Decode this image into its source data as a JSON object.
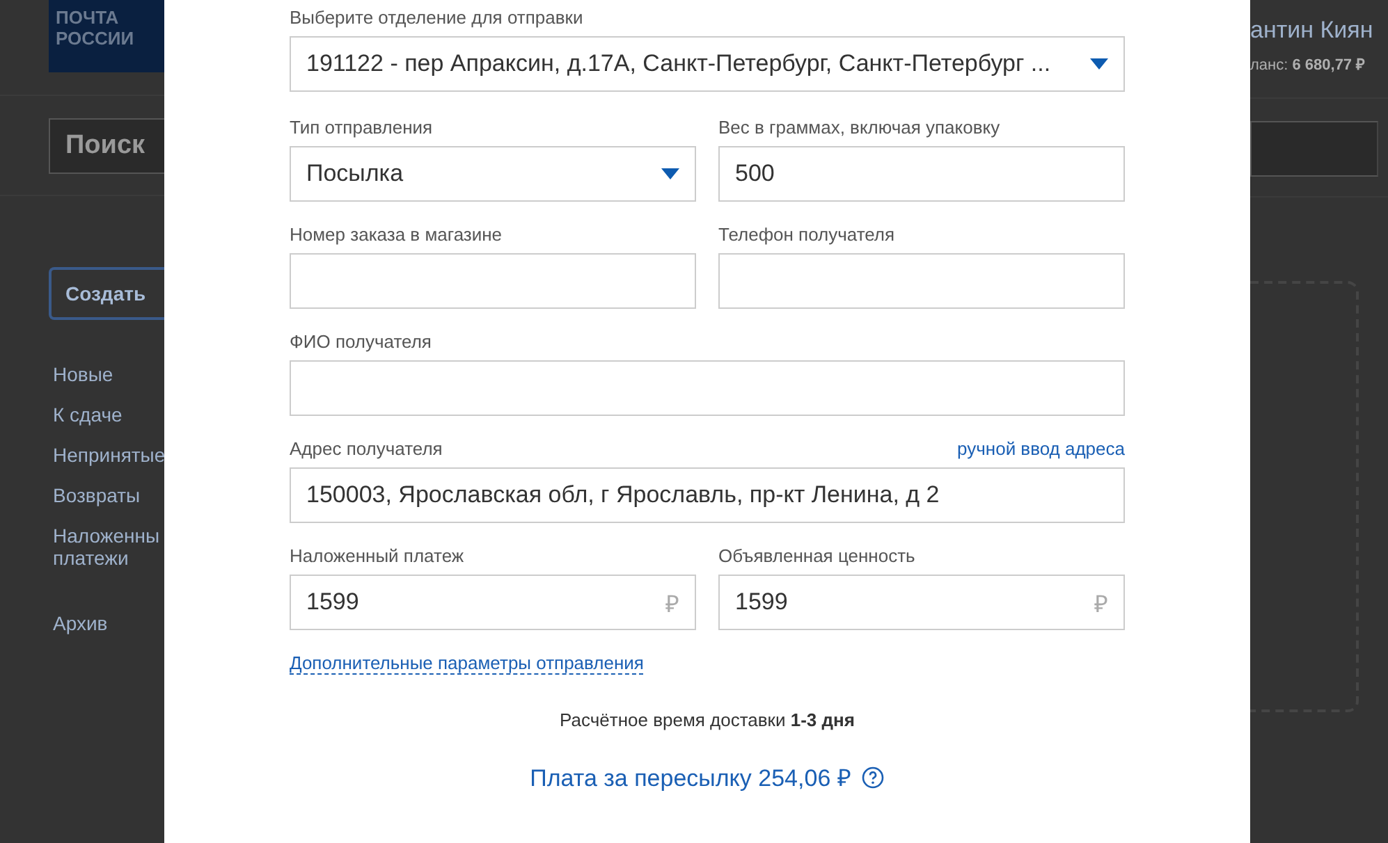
{
  "background": {
    "logo": [
      "ПОЧТА",
      "РОССИИ"
    ],
    "search": {
      "placeholder": "Поиск"
    },
    "create_button": "Создать",
    "nav": [
      {
        "label": "Новые"
      },
      {
        "label": "К сдаче"
      },
      {
        "label": "Непринятые"
      },
      {
        "label": "Возвраты"
      },
      {
        "label": "Наложенны платежи"
      },
      {
        "label": "Архив"
      }
    ],
    "user_name": "антин Киян",
    "balance_label": "ланс:",
    "balance": "6 680,77 ₽"
  },
  "modal": {
    "office": {
      "label": "Выберите отделение для отправки",
      "value": "191122 - пер Апраксин, д.17А, Санкт-Петербург, Санкт-Петербург ..."
    },
    "fields": [
      {
        "kind": "select",
        "label": "Тип отправления",
        "value": "Посылка"
      },
      {
        "kind": "input",
        "label": "Вес в граммах, включая упаковку",
        "value": "500"
      },
      {
        "kind": "input",
        "label": "Номер заказа в магазине"
      },
      {
        "kind": "input",
        "label": "Телефон получателя"
      },
      {
        "kind": "input",
        "label": "ФИО получателя",
        "wide": true
      },
      {
        "kind": "input",
        "label": "Адрес получателя",
        "value": "150003, Ярославская обл, г Ярославль, пр-кт Ленина, д 2",
        "wide": true,
        "link": "ручной ввод адреса"
      },
      {
        "kind": "money",
        "label": "Наложенный платеж",
        "value": "1599",
        "currency": "₽"
      },
      {
        "kind": "money",
        "label": "Объявленная ценность",
        "value": "1599",
        "currency": "₽"
      }
    ],
    "more_link": "Дополнительные параметры отправления",
    "delivery": "Расчётное время доставки **1-3 дня**",
    "fee": "Плата за пересылку 254,06 ₽"
  }
}
